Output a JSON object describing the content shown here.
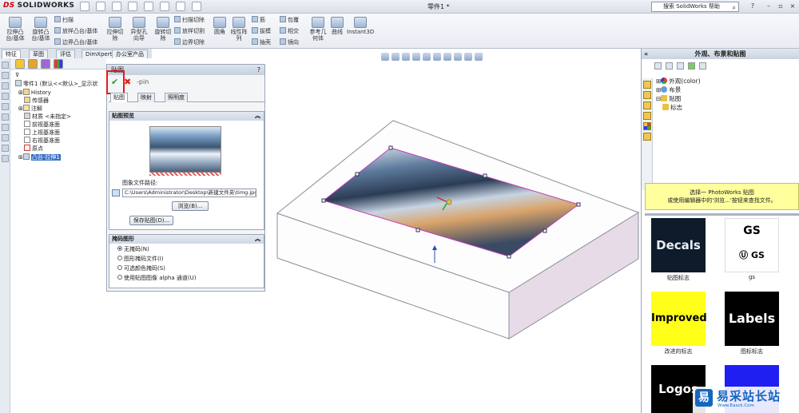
{
  "titlebar": {
    "app_name": "SOLIDWORKS",
    "document_title": "零件1 *",
    "search_placeholder": "搜索 SolidWorks 帮助"
  },
  "ribbon": {
    "large_buttons": [
      {
        "label": "拉伸凸\n台/基体"
      },
      {
        "label": "旋转凸\n台/基体"
      },
      {
        "label": "拉伸切\n除"
      },
      {
        "label": "异型孔\n向导"
      },
      {
        "label": "旋转切\n除"
      },
      {
        "label": "圆角"
      },
      {
        "label": "线性阵\n列"
      },
      {
        "label": "参考几\n何体"
      },
      {
        "label": "曲线"
      },
      {
        "label": "Instant3D"
      }
    ],
    "small_buttons": [
      "扫描",
      "放样凸台/基体",
      "边界凸台/基体",
      "扫描切除",
      "放样切割",
      "边界切除",
      "筋",
      "拔模",
      "抽壳",
      "包覆",
      "相交",
      "镜向"
    ]
  },
  "tabs": [
    "特征",
    "草图",
    "评估",
    "DimXpert",
    "办公室产品"
  ],
  "feature_tree": [
    {
      "label": "零件1 (默认<<默认>_显示状"
    },
    {
      "label": "History"
    },
    {
      "label": "传感器"
    },
    {
      "label": "注解"
    },
    {
      "label": "材质 <未指定>"
    },
    {
      "label": "前视基准面"
    },
    {
      "label": "上视基准面"
    },
    {
      "label": "右视基准面"
    },
    {
      "label": "原点"
    },
    {
      "label": "凸台-拉伸1"
    }
  ],
  "property_manager": {
    "title": "贴图",
    "help": "?",
    "pin_icon": "-pin",
    "tabs": [
      "贴图",
      "映射",
      "照明度"
    ],
    "preview_group": "贴图预览",
    "path_label": "图象文件路径:",
    "path_value": "C:\\Users\\Administrator\\Desktop\\新建文件夹\\timg.jpg",
    "browse_button": "浏览(B)...",
    "save_button": "保存贴图(D)...",
    "mask_group": "掩码图形",
    "mask_options": [
      {
        "label": "无掩码(N)",
        "selected": true
      },
      {
        "label": "图形掩码文件(I)",
        "selected": false
      },
      {
        "label": "可选颜色掩码(S)",
        "selected": false
      },
      {
        "label": "使用贴图图像 alpha 通道(U)",
        "selected": false
      }
    ]
  },
  "task_pane": {
    "title": "外观、布景和贴图",
    "collapse": "«",
    "tree": [
      {
        "label": "外观(color)"
      },
      {
        "label": "布景"
      },
      {
        "label": "贴图"
      },
      {
        "label": "标志"
      }
    ],
    "hint_line1": "选择一 PhotoWorks 贴图",
    "hint_line2": "或使用编辑器中的'浏览...'按钮来查找文件。",
    "gallery": [
      {
        "label": "贴图标志",
        "image_text": "Decals"
      },
      {
        "label": "gs",
        "image_text": "GS"
      },
      {
        "label": "改进的标志",
        "image_text": "Improved"
      },
      {
        "label": "图标标志",
        "image_text": "Labels"
      },
      {
        "label": "",
        "image_text": "Logos"
      },
      {
        "label": "",
        "image_text": ""
      }
    ]
  },
  "watermark": {
    "logo": "易",
    "text": "易采站长站",
    "sub": "Www.Easck.Com"
  },
  "colors": {
    "accent": "#1d4fa5",
    "highlight_box": "#e21b1b",
    "ok_green": "#2aa12a",
    "decal_border": "#c03cb8",
    "box_side": "#e7dbe8"
  }
}
